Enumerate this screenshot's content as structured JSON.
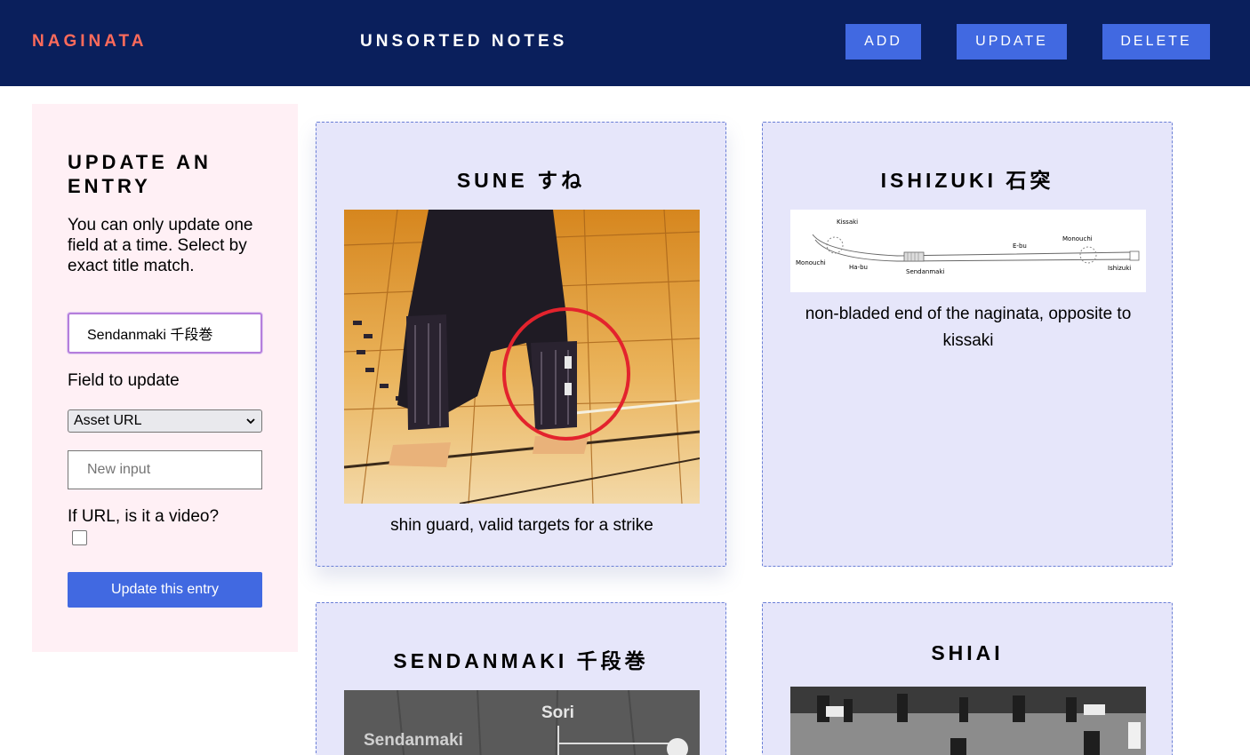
{
  "header": {
    "brand": "NAGINATA",
    "title": "UNSORTED NOTES",
    "buttons": {
      "add": "ADD",
      "update": "UPDATE",
      "delete": "DELETE"
    }
  },
  "update_panel": {
    "heading": "UPDATE AN ENTRY",
    "description": "You can only update one field at a time. Select by exact title match.",
    "title_input_value": "Sendanmaki 千段巻",
    "field_label": "Field to update",
    "field_selected": "Asset URL",
    "new_input_placeholder": "New input",
    "video_question": "If URL, is it a video?",
    "video_checked": false,
    "submit_label": "Update this entry"
  },
  "cards": [
    {
      "title": "SUNE すね",
      "description": "shin guard, valid targets for a strike",
      "image": "photo of shin guards with red circle"
    },
    {
      "title": "ISHIZUKI 石突",
      "description": "non-bladed end of the naginata, opposite to kissaki",
      "image": "naginata parts diagram",
      "diagram_labels": [
        "Kissaki",
        "Monouchi",
        "Ha-bu",
        "Sendanmaki",
        "E-bu",
        "Monouchi",
        "Ishizuki"
      ]
    },
    {
      "title": "SENDANMAKI 千段巻",
      "image": "photo of naginata",
      "image_labels": [
        "Sori",
        "Sendanmaki"
      ]
    },
    {
      "title": "SHIAI",
      "image": "black and white photo of a match"
    }
  ],
  "colors": {
    "header_bg": "#0a1f5c",
    "brand": "#ff6b5b",
    "button": "#4169e1",
    "panel_bg": "#fff0f5",
    "card_bg": "#e6e6fa"
  }
}
